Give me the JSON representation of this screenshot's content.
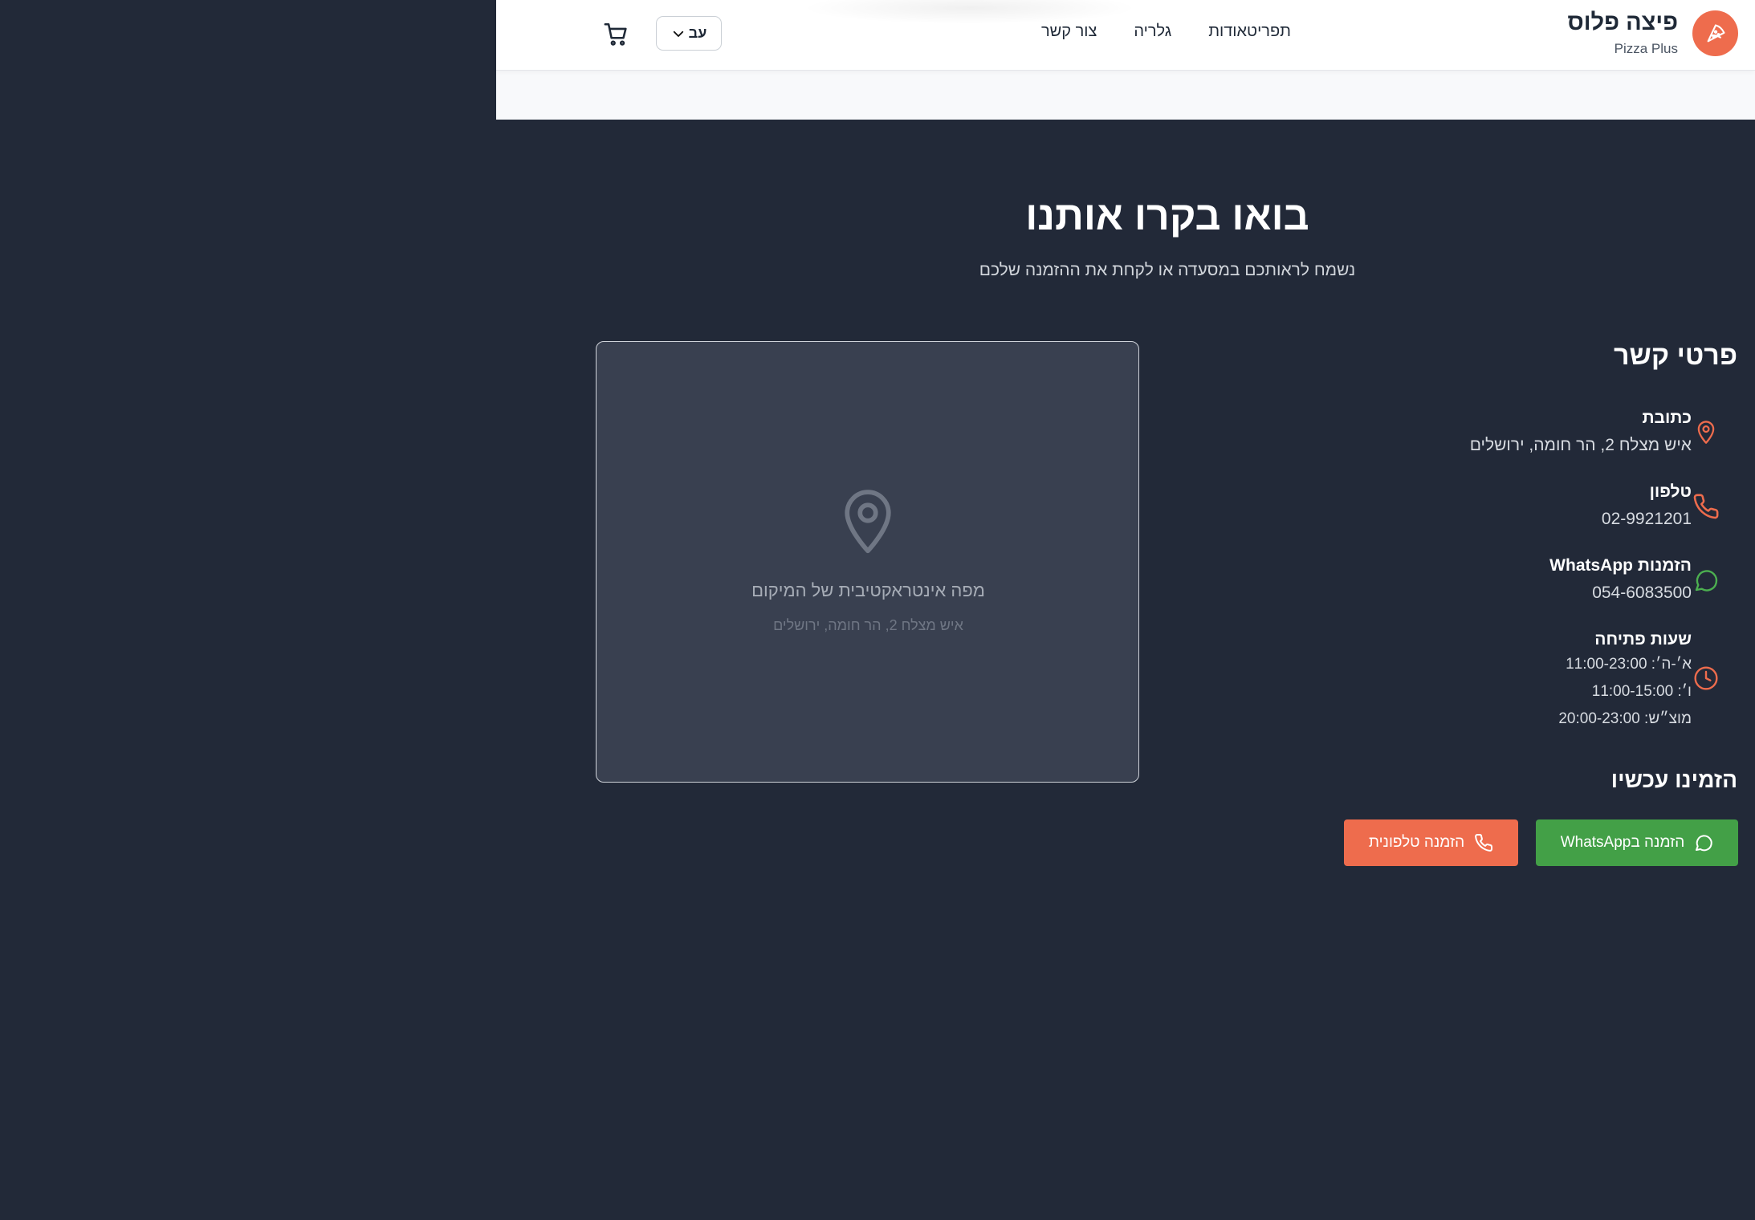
{
  "header": {
    "brand_name": "פיצה פלוס",
    "brand_sub": "Pizza Plus",
    "nav": [
      {
        "label": "תפריטאודות"
      },
      {
        "label": "גלריה"
      },
      {
        "label": "צור קשר"
      }
    ],
    "language": "עב",
    "icons": {
      "logo": "pizza-slice-icon",
      "cart": "shopping-cart-icon",
      "lang": "chevron-down-icon"
    }
  },
  "section": {
    "title": "בואו בקרו אותנו",
    "subtitle": "נשמח לראותכם במסעדה או לקחת את ההזמנה שלכם"
  },
  "map": {
    "label": "מפה אינטראקטיבית של המיקום",
    "address": "איש מצלח 2, הר חומה, ירושלים"
  },
  "contact": {
    "title": "פרטי קשר",
    "address_label": "כתובת",
    "address_value": "איש מצלח 2, הר חומה, ירושלים",
    "phone_label": "טלפון",
    "phone_value": "02-9921201",
    "whatsapp_label": "הזמנות WhatsApp",
    "whatsapp_value": "054-6083500",
    "hours_label": "שעות פתיחה",
    "hours": [
      "א׳-ה׳: 11:00-23:00",
      "ו׳: 11:00-15:00",
      "מוצ״ש: 20:00-23:00"
    ]
  },
  "order": {
    "title": "הזמינו עכשיו",
    "whatsapp_button": "הזמנה בWhatsApp",
    "phone_button": "הזמנה טלפונית"
  },
  "colors": {
    "accent": "#ee6c4d",
    "whatsapp": "#43a047",
    "dark_bg": "#222938",
    "map_bg": "#394050"
  }
}
